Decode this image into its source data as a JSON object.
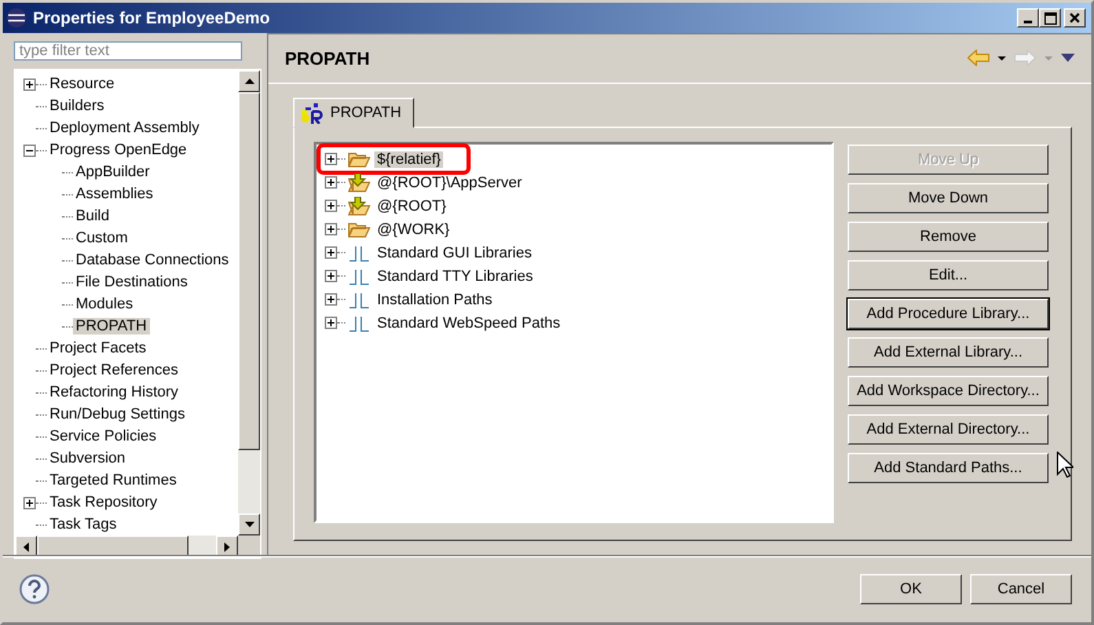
{
  "window": {
    "title": "Properties for EmployeeDemo"
  },
  "filter": {
    "placeholder": "type filter text"
  },
  "nav_tree": [
    {
      "label": "Resource",
      "expanded": false,
      "selected": false
    },
    {
      "label": "Builders",
      "selected": false
    },
    {
      "label": "Deployment Assembly",
      "selected": false
    },
    {
      "label": "Progress OpenEdge",
      "expanded": true,
      "selected": false,
      "children": [
        {
          "label": "AppBuilder",
          "selected": false
        },
        {
          "label": "Assemblies",
          "selected": false
        },
        {
          "label": "Build",
          "selected": false
        },
        {
          "label": "Custom",
          "selected": false
        },
        {
          "label": "Database Connections",
          "selected": false
        },
        {
          "label": "File Destinations",
          "selected": false
        },
        {
          "label": "Modules",
          "selected": false
        },
        {
          "label": "PROPATH",
          "selected": true
        }
      ]
    },
    {
      "label": "Project Facets",
      "selected": false
    },
    {
      "label": "Project References",
      "selected": false
    },
    {
      "label": "Refactoring History",
      "selected": false
    },
    {
      "label": "Run/Debug Settings",
      "selected": false
    },
    {
      "label": "Service Policies",
      "selected": false
    },
    {
      "label": "Subversion",
      "selected": false
    },
    {
      "label": "Targeted Runtimes",
      "selected": false
    },
    {
      "label": "Task Repository",
      "expanded": false,
      "selected": false
    },
    {
      "label": "Task Tags",
      "selected": false
    }
  ],
  "page": {
    "title": "PROPATH"
  },
  "tabs": [
    {
      "label": "PROPATH",
      "selected": true
    }
  ],
  "propath": [
    {
      "label": "${relatief}",
      "kind": "folder",
      "selected": true,
      "highlighted": true
    },
    {
      "label": "@{ROOT}\\AppServer",
      "kind": "linked-folder",
      "selected": false,
      "highlighted": false
    },
    {
      "label": "@{ROOT}",
      "kind": "linked-folder",
      "selected": false,
      "highlighted": false
    },
    {
      "label": "@{WORK}",
      "kind": "folder",
      "selected": false,
      "highlighted": false
    },
    {
      "label": "Standard GUI Libraries",
      "kind": "library",
      "selected": false,
      "highlighted": false
    },
    {
      "label": "Standard TTY Libraries",
      "kind": "library",
      "selected": false,
      "highlighted": false
    },
    {
      "label": "Installation Paths",
      "kind": "library",
      "selected": false,
      "highlighted": false
    },
    {
      "label": "Standard WebSpeed Paths",
      "kind": "library",
      "selected": false,
      "highlighted": false
    }
  ],
  "actions": [
    {
      "label": "Move Up",
      "disabled": true,
      "default": false
    },
    {
      "label": "Move Down",
      "disabled": false,
      "default": false
    },
    {
      "label": "Remove",
      "disabled": false,
      "default": false
    },
    {
      "label": "Edit...",
      "disabled": false,
      "default": false
    },
    {
      "label": "Add Procedure Library...",
      "disabled": false,
      "default": true
    },
    {
      "label": "Add External Library...",
      "disabled": false,
      "default": false
    },
    {
      "label": "Add Workspace Directory...",
      "disabled": false,
      "default": false
    },
    {
      "label": "Add External Directory...",
      "disabled": false,
      "default": false
    },
    {
      "label": "Add Standard Paths...",
      "disabled": false,
      "default": false
    }
  ],
  "footer": {
    "buttons": [
      "OK",
      "Cancel"
    ]
  }
}
